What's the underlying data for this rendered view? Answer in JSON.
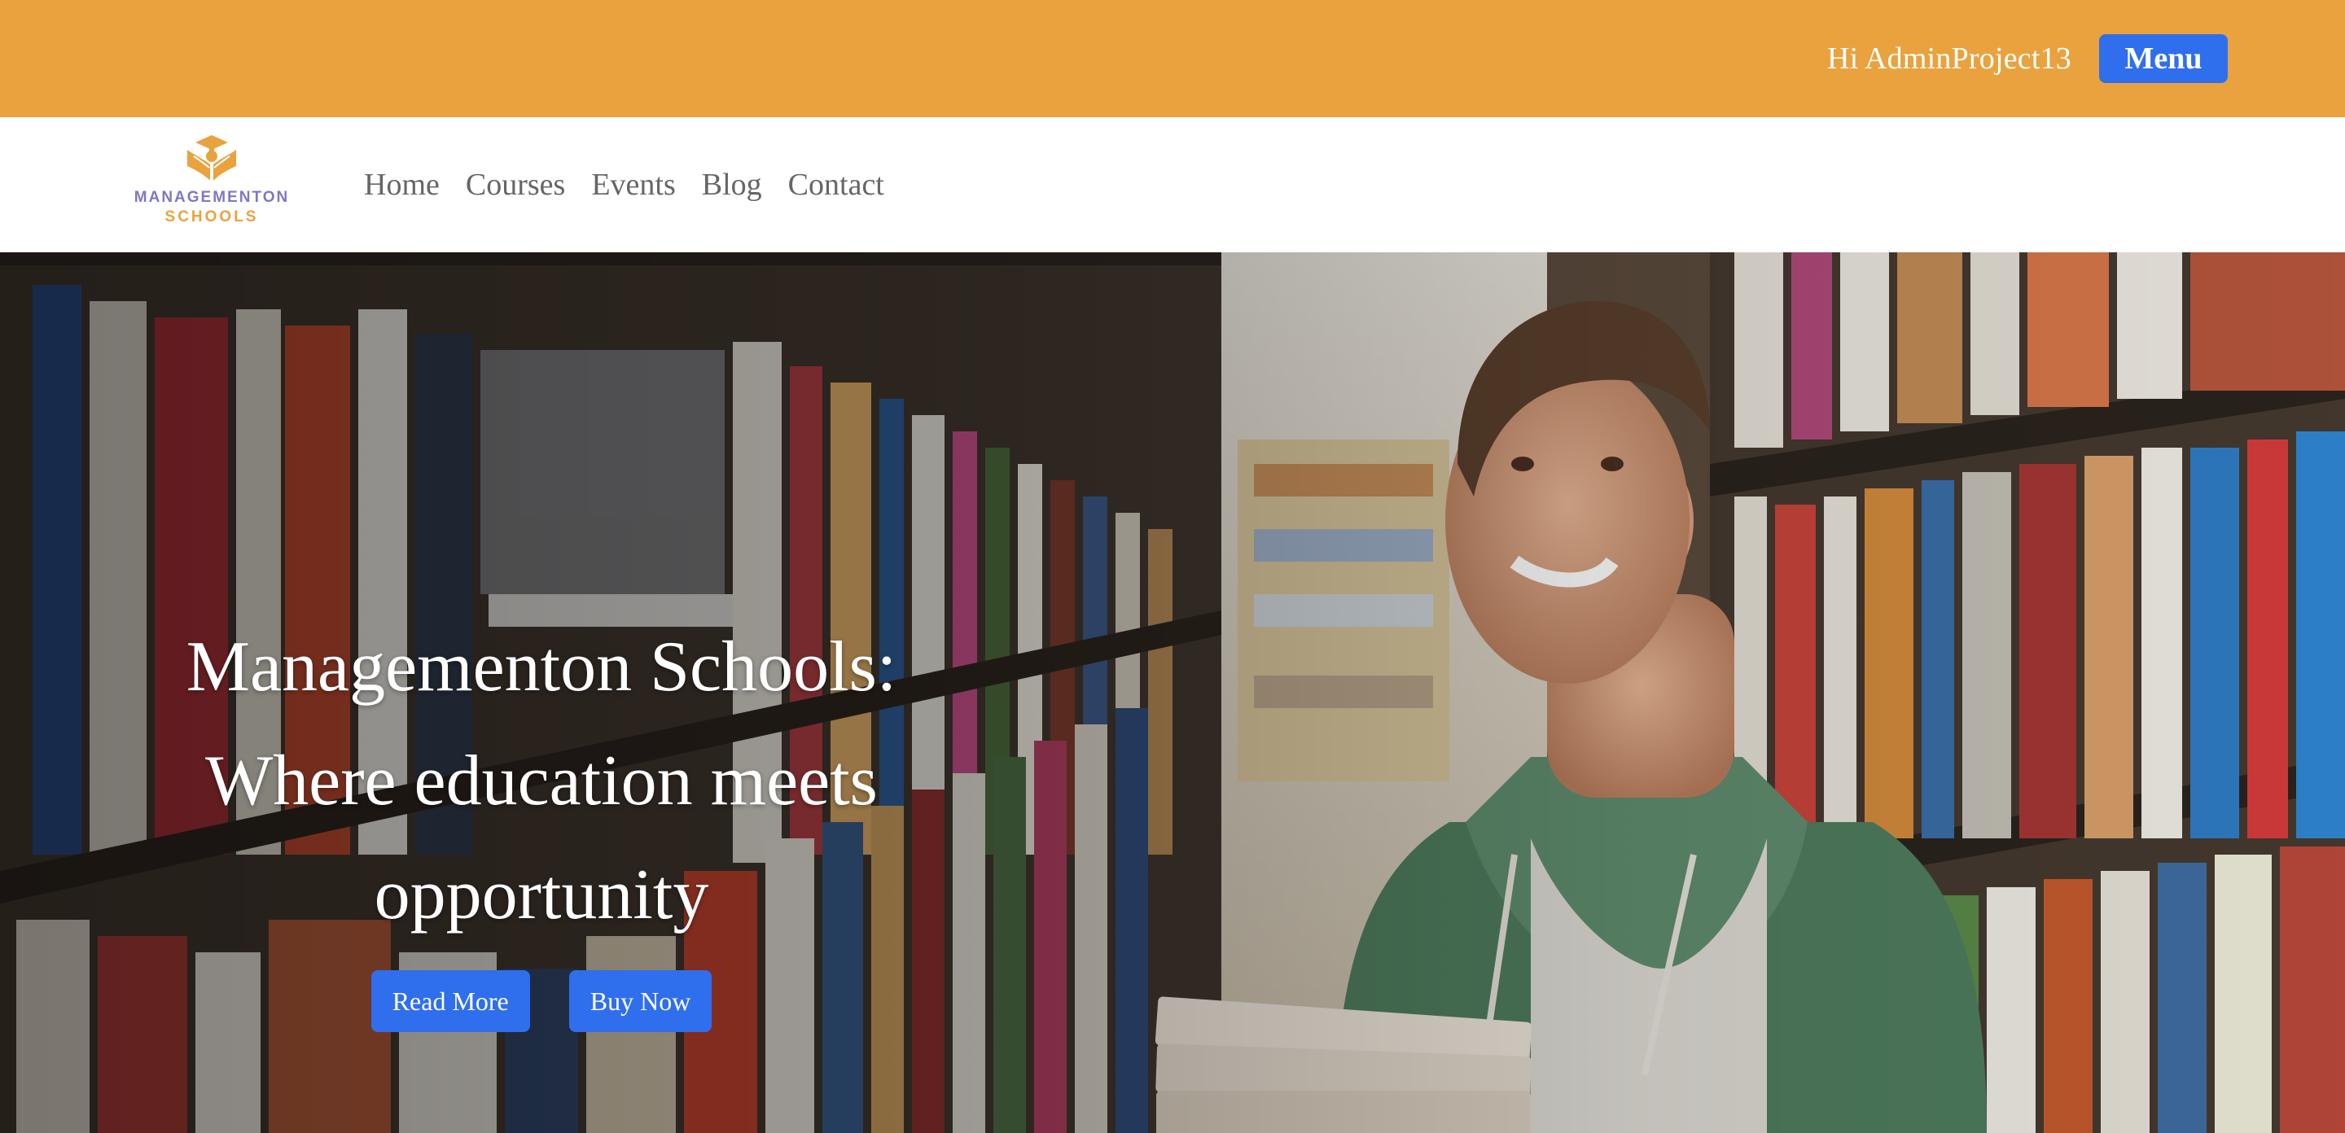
{
  "topbar": {
    "greeting": "Hi AdminProject13",
    "menu_label": "Menu"
  },
  "logo": {
    "line1": "MANAGEMENTON",
    "line2": "SCHOOLS"
  },
  "nav": {
    "items": [
      {
        "label": "Home"
      },
      {
        "label": "Courses"
      },
      {
        "label": "Events"
      },
      {
        "label": "Blog"
      },
      {
        "label": "Contact"
      }
    ]
  },
  "hero": {
    "title_line1": "Managementon Schools:",
    "title_line2": "Where education meets",
    "title_line3": "opportunity",
    "read_more_label": "Read More",
    "buy_now_label": "Buy Now"
  },
  "colors": {
    "topbar_bg": "#E9A23E",
    "button_blue": "#2F6FED",
    "logo_purple": "#7E78C3",
    "logo_orange": "#E9A23E"
  },
  "icons": {
    "logo": "graduation-book-logo-icon"
  }
}
